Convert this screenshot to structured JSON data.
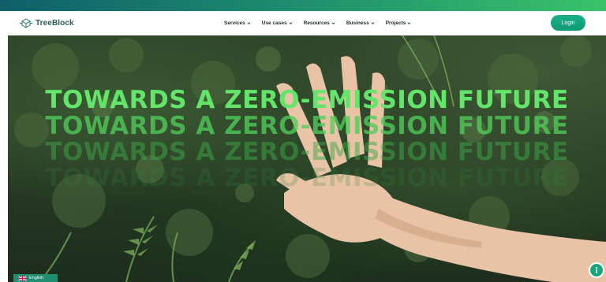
{
  "brand": {
    "name": "TreeBlock",
    "icon": "treeblock-logo-icon"
  },
  "nav": {
    "items": [
      {
        "label": "Services",
        "icon": "chevron-down-icon"
      },
      {
        "label": "Use cases",
        "icon": "chevron-down-icon"
      },
      {
        "label": "Resources",
        "icon": "chevron-down-icon"
      },
      {
        "label": "Business",
        "icon": "chevron-down-icon"
      },
      {
        "label": "Projects",
        "icon": "chevron-down-icon"
      }
    ],
    "login_label": "Login"
  },
  "hero": {
    "headline": "TOWARDS A ZERO-EMISSION FUTURE",
    "headline_color": "#63e56a"
  },
  "language": {
    "selected": "English",
    "icon": "uk-flag-icon"
  },
  "info_button": {
    "icon": "info-icon"
  },
  "colors": {
    "accent": "#1ab088",
    "brand_text": "#2a5c58",
    "language_bg": "#1f8f6f"
  }
}
